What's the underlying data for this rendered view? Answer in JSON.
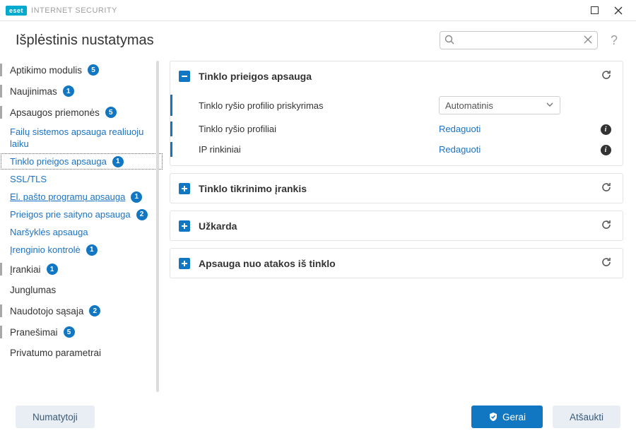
{
  "titlebar": {
    "brand": "eset",
    "product": "INTERNET SECURITY"
  },
  "header": {
    "title": "Išplėstinis nustatymas",
    "search_placeholder": ""
  },
  "sidebar": {
    "items": [
      {
        "label": "Aptikimo modulis",
        "badge": "5",
        "type": "top"
      },
      {
        "label": "Naujinimas",
        "badge": "1",
        "type": "top"
      },
      {
        "label": "Apsaugos priemonės",
        "badge": "5",
        "type": "top"
      },
      {
        "label": "Failų sistemos apsauga realiuoju laiku",
        "type": "sub"
      },
      {
        "label": "Tinklo prieigos apsauga",
        "badge": "1",
        "type": "sub",
        "selected": true
      },
      {
        "label": "SSL/TLS",
        "type": "sub"
      },
      {
        "label": "El. pašto programų apsauga",
        "badge": "1",
        "type": "sub",
        "underline": true
      },
      {
        "label": "Prieigos prie saityno apsauga",
        "badge": "2",
        "type": "sub"
      },
      {
        "label": "Naršyklės apsauga",
        "type": "sub"
      },
      {
        "label": "Įrenginio kontrolė",
        "badge": "1",
        "type": "sub"
      },
      {
        "label": "Įrankiai",
        "badge": "1",
        "type": "top"
      },
      {
        "label": "Junglumas",
        "type": "top",
        "nobar": true
      },
      {
        "label": "Naudotojo sąsaja",
        "badge": "2",
        "type": "top"
      },
      {
        "label": "Pranešimai",
        "badge": "5",
        "type": "top"
      },
      {
        "label": "Privatumo parametrai",
        "type": "top",
        "nobar": true
      }
    ]
  },
  "content": {
    "panels": [
      {
        "title": "Tinklo prieigos apsauga",
        "expanded": true,
        "rows": [
          {
            "label": "Tinklo ryšio profilio priskyrimas",
            "control": "select",
            "value": "Automatinis"
          },
          {
            "label": "Tinklo ryšio profiliai",
            "control": "link",
            "value": "Redaguoti",
            "info": true
          },
          {
            "label": "IP rinkiniai",
            "control": "link",
            "value": "Redaguoti",
            "info": true
          }
        ]
      },
      {
        "title": "Tinklo tikrinimo įrankis",
        "expanded": false
      },
      {
        "title": "Užkarda",
        "expanded": false
      },
      {
        "title": "Apsauga nuo atakos iš tinklo",
        "expanded": false
      }
    ]
  },
  "footer": {
    "default": "Numatytoji",
    "ok": "Gerai",
    "cancel": "Atšaukti"
  }
}
